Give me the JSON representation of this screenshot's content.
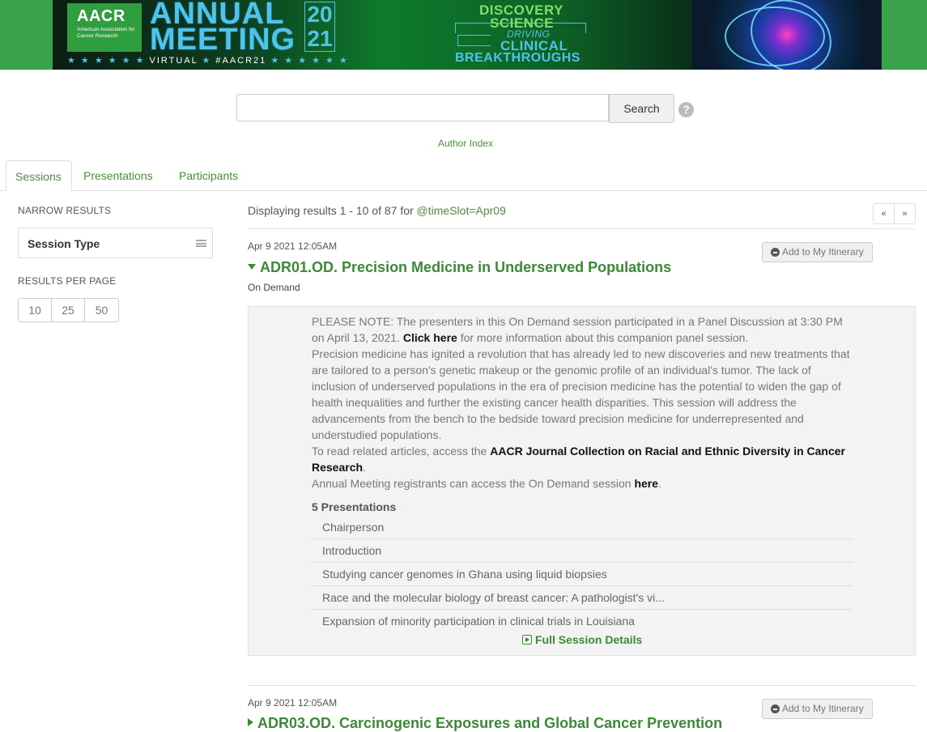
{
  "banner": {
    "org_short": "AACR",
    "org_full": "American Association for Cancer Research",
    "annual": "ANNUAL",
    "meeting": "MEETING",
    "year_top": "20",
    "year_bottom": "21",
    "virtual_line": "VIRTUAL",
    "hashtag": "#AACR21",
    "tagline_1": "DISCOVERY",
    "tagline_2": "SCIENCE",
    "tagline_3": "DRIVING",
    "tagline_4": "CLINICAL",
    "tagline_5": "BREAKTHROUGHS"
  },
  "search": {
    "value": "",
    "placeholder": "",
    "button_label": "Search",
    "help_label": "?",
    "author_index": "Author Index"
  },
  "tabs": [
    {
      "label": "Sessions",
      "active": true
    },
    {
      "label": "Presentations",
      "active": false
    },
    {
      "label": "Participants",
      "active": false
    }
  ],
  "sidebar": {
    "narrow_heading": "NARROW RESULTS",
    "session_type": "Session Type",
    "per_page_heading": "RESULTS PER PAGE",
    "per_page_options": [
      "10",
      "25",
      "50"
    ]
  },
  "results": {
    "prefix": "Displaying results 1 - 10 of 87 for",
    "query": "@timeSlot=Apr09",
    "pager_prev": "«",
    "pager_next": "»"
  },
  "sessions": [
    {
      "date": "Apr 9 2021 12:05AM",
      "itinerary_label": "Add to My Itinerary",
      "title": "ADR01.OD. Precision Medicine in Underserved Populations",
      "type": "On Demand",
      "note_part1": "PLEASE NOTE: The presenters in this On Demand session participated in a Panel Discussion at 3:30 PM on April 13, 2021.",
      "note_link": "Click here",
      "note_part2": "for more information about this companion panel session.",
      "description": "Precision medicine has ignited a revolution that has already led to new discoveries and new treatments that are tailored to a person's genetic makeup or the genomic profile of an individual's tumor. The lack of inclusion of underserved populations in the era of precision medicine has the potential to widen the gap of health inequalities and further the existing cancer health disparities. This session will address the advancements from the bench to the bedside toward precision medicine for underrepresented and understudied populations.",
      "related_prefix": "To read related articles, access the",
      "related_link": "AACR Journal Collection on Racial and Ethnic Diversity in Cancer Research",
      "related_suffix": ".",
      "access_prefix": "Annual Meeting registrants can access the On Demand session",
      "access_link": "here",
      "access_suffix": ".",
      "presentations_count": "5 Presentations",
      "presentations": [
        "Chairperson",
        "Introduction",
        "Studying cancer genomes in Ghana using liquid biopsies",
        "Race and the molecular biology of breast cancer: A pathologist's vi...",
        "Expansion of minority participation in clinical trials in Louisiana"
      ],
      "full_details": "Full Session Details"
    },
    {
      "date": "Apr 9 2021 12:05AM",
      "itinerary_label": "Add to My Itinerary",
      "title": "ADR03.OD. Carcinogenic Exposures and Global Cancer Prevention"
    }
  ],
  "colors": {
    "accent_green": "#3a8a36",
    "link_green": "#4a8f3a",
    "banner_green": "#3aa24a"
  }
}
